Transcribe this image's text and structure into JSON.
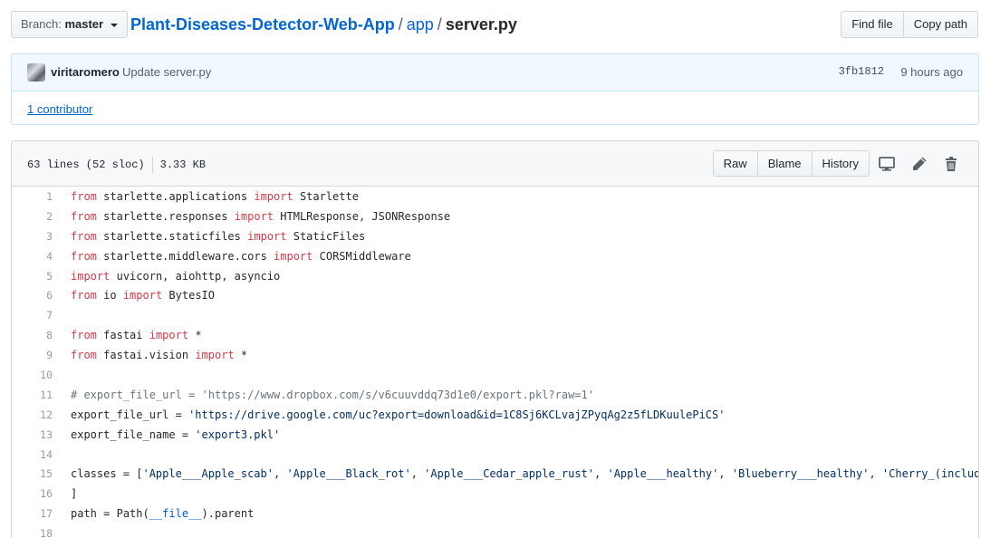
{
  "topbar": {
    "branch_prefix": "Branch:",
    "branch_name": "master",
    "repo": "Plant-Diseases-Detector-Web-App",
    "sep": "/",
    "folder": "app",
    "file": "server.py",
    "find_file": "Find file",
    "copy_path": "Copy path"
  },
  "commit": {
    "author": "viritaromero",
    "message": "Update server.py",
    "sha": "3fb1812",
    "time": "9 hours ago",
    "contributors": "1 contributor"
  },
  "file": {
    "lines": "63 lines (52 sloc)",
    "size": "3.33 KB",
    "raw": "Raw",
    "blame": "Blame",
    "history": "History"
  },
  "code_lines": [
    {
      "n": "1",
      "text": "from starlette.applications import Starlette"
    },
    {
      "n": "2",
      "text": "from starlette.responses import HTMLResponse, JSONResponse"
    },
    {
      "n": "3",
      "text": "from starlette.staticfiles import StaticFiles"
    },
    {
      "n": "4",
      "text": "from starlette.middleware.cors import CORSMiddleware"
    },
    {
      "n": "5",
      "text": "import uvicorn, aiohttp, asyncio"
    },
    {
      "n": "6",
      "text": "from io import BytesIO"
    },
    {
      "n": "7",
      "text": ""
    },
    {
      "n": "8",
      "text": "from fastai import *"
    },
    {
      "n": "9",
      "text": "from fastai.vision import *"
    },
    {
      "n": "10",
      "text": ""
    },
    {
      "n": "11",
      "text": "# export_file_url = 'https://www.dropbox.com/s/v6cuuvddq73d1e0/export.pkl?raw=1'"
    },
    {
      "n": "12",
      "text": "export_file_url = 'https://drive.google.com/uc?export=download&id=1C8Sj6KCLvajZPyqAg2z5fLDKuulePiCS'"
    },
    {
      "n": "13",
      "text": "export_file_name = 'export3.pkl'"
    },
    {
      "n": "14",
      "text": ""
    },
    {
      "n": "15",
      "text": "classes = ['Apple___Apple_scab', 'Apple___Black_rot', 'Apple___Cedar_apple_rust', 'Apple___healthy', 'Blueberry___healthy', 'Cherry_(including_"
    },
    {
      "n": "16",
      "text": "]"
    },
    {
      "n": "17",
      "text": "path = Path(__file__).parent"
    },
    {
      "n": "18",
      "text": ""
    }
  ]
}
